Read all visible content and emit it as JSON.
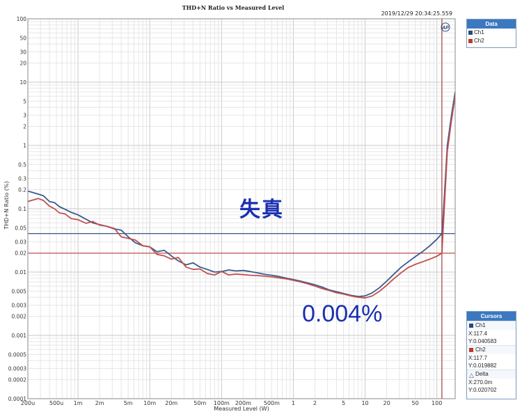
{
  "chart_data": {
    "type": "line",
    "title": "THD+N Ratio vs Measured Level",
    "timestamp": "2019/12/29 20:34:25.559",
    "xlabel": "Measured Level (W)",
    "ylabel": "THD+N Ratio (%)",
    "xscale": "log",
    "yscale": "log",
    "xlim": [
      0.0002,
      180
    ],
    "ylim": [
      0.0001,
      100
    ],
    "grid": true,
    "x_ticks": [
      {
        "v": 0.0002,
        "label": "200u"
      },
      {
        "v": 0.0005,
        "label": "500u"
      },
      {
        "v": 0.001,
        "label": "1m"
      },
      {
        "v": 0.002,
        "label": "2m"
      },
      {
        "v": 0.005,
        "label": "5m"
      },
      {
        "v": 0.01,
        "label": "10m"
      },
      {
        "v": 0.02,
        "label": "20m"
      },
      {
        "v": 0.05,
        "label": "50m"
      },
      {
        "v": 0.1,
        "label": "100m"
      },
      {
        "v": 0.2,
        "label": "200m"
      },
      {
        "v": 0.5,
        "label": "500m"
      },
      {
        "v": 1,
        "label": "1"
      },
      {
        "v": 2,
        "label": "2"
      },
      {
        "v": 5,
        "label": "5"
      },
      {
        "v": 10,
        "label": "10"
      },
      {
        "v": 20,
        "label": "20"
      },
      {
        "v": 50,
        "label": "50"
      },
      {
        "v": 100,
        "label": "100"
      }
    ],
    "y_ticks": [
      {
        "v": 100,
        "label": "100"
      },
      {
        "v": 50,
        "label": "50"
      },
      {
        "v": 30,
        "label": "30"
      },
      {
        "v": 20,
        "label": "20"
      },
      {
        "v": 10,
        "label": "10"
      },
      {
        "v": 5,
        "label": "5"
      },
      {
        "v": 3,
        "label": "3"
      },
      {
        "v": 2,
        "label": "2"
      },
      {
        "v": 1,
        "label": "1"
      },
      {
        "v": 0.5,
        "label": "0.5"
      },
      {
        "v": 0.3,
        "label": "0.3"
      },
      {
        "v": 0.2,
        "label": "0.2"
      },
      {
        "v": 0.1,
        "label": "0.1"
      },
      {
        "v": 0.05,
        "label": "0.05"
      },
      {
        "v": 0.03,
        "label": "0.03"
      },
      {
        "v": 0.02,
        "label": "0.02"
      },
      {
        "v": 0.01,
        "label": "0.01"
      },
      {
        "v": 0.005,
        "label": "0.005"
      },
      {
        "v": 0.003,
        "label": "0.003"
      },
      {
        "v": 0.002,
        "label": "0.002"
      },
      {
        "v": 0.001,
        "label": "0.001"
      },
      {
        "v": 0.0005,
        "label": "0.0005"
      },
      {
        "v": 0.0003,
        "label": "0.0003"
      },
      {
        "v": 0.0002,
        "label": "0.0002"
      },
      {
        "v": 0.0001,
        "label": "0.0001"
      }
    ],
    "series": [
      {
        "name": "Ch1",
        "color": "#3a5a8c",
        "x": [
          0.0002,
          0.00028,
          0.00033,
          0.0004,
          0.00047,
          0.00055,
          0.00066,
          0.0008,
          0.001,
          0.0013,
          0.0016,
          0.002,
          0.0025,
          0.0032,
          0.004,
          0.005,
          0.0063,
          0.008,
          0.01,
          0.0126,
          0.016,
          0.02,
          0.025,
          0.032,
          0.04,
          0.05,
          0.063,
          0.08,
          0.1,
          0.126,
          0.16,
          0.2,
          0.25,
          0.32,
          0.4,
          0.5,
          0.63,
          0.8,
          1,
          1.26,
          1.6,
          2,
          2.5,
          3.2,
          4,
          5,
          6.3,
          8,
          10,
          12.6,
          16,
          20,
          25,
          32,
          40,
          50,
          63,
          80,
          100,
          117.4,
          120,
          140,
          160,
          180
        ],
        "y": [
          0.19,
          0.17,
          0.16,
          0.13,
          0.125,
          0.108,
          0.098,
          0.088,
          0.08,
          0.068,
          0.06,
          0.056,
          0.053,
          0.048,
          0.046,
          0.036,
          0.029,
          0.026,
          0.025,
          0.021,
          0.022,
          0.018,
          0.015,
          0.013,
          0.014,
          0.012,
          0.011,
          0.01,
          0.0102,
          0.0108,
          0.0104,
          0.0106,
          0.0102,
          0.0097,
          0.0092,
          0.0089,
          0.0085,
          0.008,
          0.0076,
          0.0072,
          0.0067,
          0.0063,
          0.0058,
          0.0052,
          0.0049,
          0.0046,
          0.0043,
          0.0041,
          0.0042,
          0.0047,
          0.0057,
          0.0072,
          0.0092,
          0.012,
          0.0145,
          0.0175,
          0.021,
          0.026,
          0.033,
          0.040583,
          0.05,
          1.0,
          3.0,
          7.0
        ]
      },
      {
        "name": "Ch2",
        "color": "#c0504d",
        "x": [
          0.0002,
          0.00028,
          0.00033,
          0.0004,
          0.00047,
          0.00055,
          0.00066,
          0.0008,
          0.001,
          0.0013,
          0.0016,
          0.002,
          0.0025,
          0.0032,
          0.004,
          0.005,
          0.0063,
          0.008,
          0.01,
          0.0126,
          0.016,
          0.02,
          0.025,
          0.032,
          0.04,
          0.05,
          0.063,
          0.08,
          0.1,
          0.126,
          0.16,
          0.2,
          0.25,
          0.32,
          0.4,
          0.5,
          0.63,
          0.8,
          1,
          1.26,
          1.6,
          2,
          2.5,
          3.2,
          4,
          5,
          6.3,
          8,
          10,
          12.6,
          16,
          20,
          25,
          32,
          40,
          50,
          63,
          80,
          100,
          117.7,
          120,
          140,
          160,
          180
        ],
        "y": [
          0.13,
          0.145,
          0.135,
          0.11,
          0.1,
          0.086,
          0.083,
          0.07,
          0.067,
          0.059,
          0.063,
          0.055,
          0.053,
          0.049,
          0.036,
          0.034,
          0.032,
          0.026,
          0.025,
          0.019,
          0.018,
          0.016,
          0.017,
          0.012,
          0.011,
          0.0112,
          0.0095,
          0.009,
          0.0102,
          0.009,
          0.0093,
          0.0091,
          0.0089,
          0.0088,
          0.0086,
          0.0084,
          0.0081,
          0.0078,
          0.0074,
          0.007,
          0.0065,
          0.006,
          0.0055,
          0.0051,
          0.0047,
          0.0045,
          0.0042,
          0.004,
          0.0039,
          0.0042,
          0.005,
          0.0062,
          0.0078,
          0.0098,
          0.0118,
          0.0132,
          0.0145,
          0.016,
          0.0178,
          0.019882,
          0.03,
          0.8,
          2.5,
          6.0
        ]
      }
    ],
    "reference_lines": [
      {
        "orient": "h",
        "y": 0.040583,
        "color": "#3a5a8c"
      },
      {
        "orient": "h",
        "y": 0.019882,
        "color": "#c0504d"
      },
      {
        "orient": "v",
        "x": 117.4,
        "color": "#3a5a8c"
      },
      {
        "orient": "v",
        "x": 117.7,
        "color": "#c0504d"
      }
    ]
  },
  "legend": {
    "title": "Data",
    "items": [
      {
        "label": "Ch1",
        "color": "#2b4a7a"
      },
      {
        "label": "Ch2",
        "color": "#c0392b"
      }
    ]
  },
  "cursors": {
    "title": "Cursors",
    "ch1": {
      "label": "Ch1",
      "color": "#2b4a7a",
      "x": "X:117.4",
      "y": "Y:0.040583"
    },
    "ch2": {
      "label": "Ch2",
      "color": "#c0392b",
      "x": "X:117.7",
      "y": "Y:0.019882"
    },
    "delta": {
      "label": "Delta",
      "x": "X:270.0m",
      "y": "Y:0.020702"
    }
  },
  "annotations": {
    "distortion": "失真",
    "min_value": "0.004%"
  },
  "logo_icon": "ap-logo-icon"
}
